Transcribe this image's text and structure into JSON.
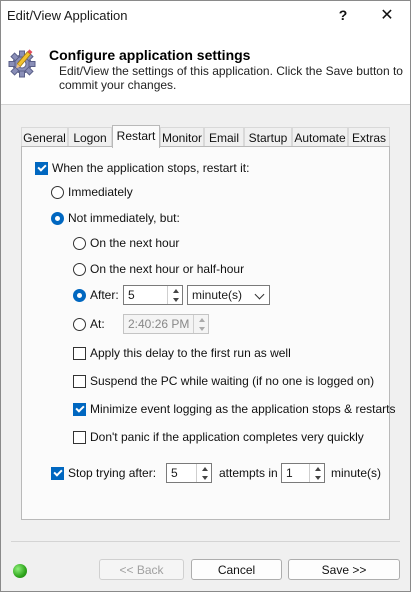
{
  "window": {
    "title": "Edit/View Application",
    "help_glyph": "?",
    "close_glyph": "✕"
  },
  "header": {
    "title": "Configure application settings",
    "subtitle": "Edit/View the settings of this application. Click the Save button to commit your changes."
  },
  "tabs": [
    {
      "label": "General",
      "active": false
    },
    {
      "label": "Logon",
      "active": false
    },
    {
      "label": "Restart",
      "active": true
    },
    {
      "label": "Monitor",
      "active": false
    },
    {
      "label": "Email",
      "active": false
    },
    {
      "label": "Startup",
      "active": false
    },
    {
      "label": "Automate",
      "active": false
    },
    {
      "label": "Extras",
      "active": false
    }
  ],
  "restart": {
    "restart_when_stops": {
      "label": "When the application stops, restart it:",
      "checked": true
    },
    "immediately": {
      "label": "Immediately",
      "selected": false
    },
    "not_immediately": {
      "label": "Not immediately, but:",
      "selected": true
    },
    "next_hour": {
      "label": "On the next hour",
      "selected": false
    },
    "next_half_hour": {
      "label": "On the next hour or half-hour",
      "selected": false
    },
    "after": {
      "label": "After:",
      "selected": true,
      "value": "5",
      "unit": "minute(s)"
    },
    "at": {
      "label": "At:",
      "selected": false,
      "value": "2:40:26 PM"
    },
    "apply_delay_first_run": {
      "label": "Apply this delay to the first run as well",
      "checked": false
    },
    "suspend_pc": {
      "label": "Suspend the PC while waiting (if no one is logged on)",
      "checked": false
    },
    "minimize_logging": {
      "label": "Minimize event logging as the application stops & restarts",
      "checked": true
    },
    "dont_panic": {
      "label": "Don't panic if the application completes very quickly",
      "checked": false
    },
    "stop_trying": {
      "label": "Stop trying after:",
      "checked": true,
      "attempts": "5",
      "attempts_label": "attempts in",
      "minutes": "1",
      "minutes_label": "minute(s)"
    }
  },
  "footer": {
    "back_label": "<< Back",
    "cancel_label": "Cancel",
    "save_label": "Save >>",
    "status_color": "#2fa51c"
  },
  "colors": {
    "accent": "#0067c0"
  }
}
